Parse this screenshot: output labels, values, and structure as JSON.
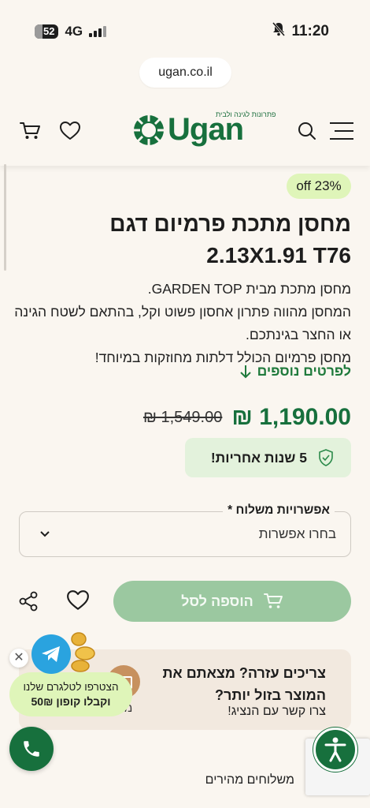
{
  "status_bar": {
    "battery": "52",
    "network": "4G",
    "time": "11:20"
  },
  "browser": {
    "url": "ugan.co.il"
  },
  "header": {
    "logo_text": "Ugan",
    "logo_tagline": "פתרונות לגינה ולבית",
    "brand_color": "#17703d"
  },
  "product": {
    "discount_badge": "off 23%",
    "title": "מחסן מתכת פרמיום דגם 2.13X1.91 T76",
    "description_lines": [
      "מחסן מתכת מבית GARDEN TOP.",
      "המחסן מהווה פתרון אחסון פשוט וקל, בהתאם לשטח הגינה או החצר בגינתכם.",
      "מחסן פרמיום הכולל דלתות מחוזקות במיוחד!"
    ],
    "more_details": "לפרטים נוספים",
    "price": "1,190.00 ₪",
    "old_price": "1,549.00 ₪",
    "warranty": "5 שנות אחריות!"
  },
  "shipping": {
    "label": "אפשרויות משלוח *",
    "selected": "בחרו אפשרות"
  },
  "actions": {
    "add_to_cart": "הוספה לסל"
  },
  "help": {
    "title": "צריכים עזרה? מצאתם את המוצר בזול יותר?",
    "subtitle": "צרו קשר עם הנציג!",
    "fragment": "מ"
  },
  "telegram_promo": {
    "line1": "הצטרפו לטלגרם שלנו",
    "line2": "וקבלו קופון 50₪",
    "close": "✕"
  },
  "footer_peek": {
    "text": "משלוחים מהירים"
  }
}
